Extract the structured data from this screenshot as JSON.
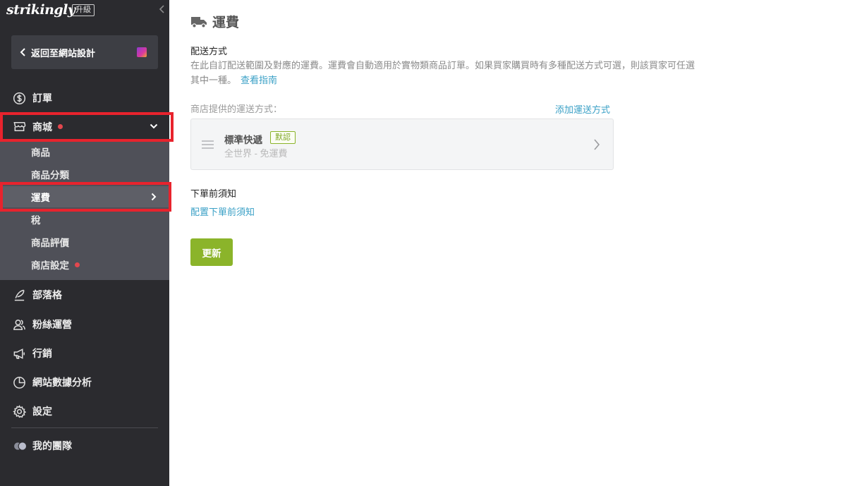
{
  "brand": {
    "logo": "strikingly",
    "upgrade": "升級"
  },
  "sidebar": {
    "back_label": "返回至網站設計",
    "items": {
      "orders": "訂單",
      "store": "商城",
      "blog": "部落格",
      "fans": "粉絲運營",
      "marketing": "行銷",
      "analytics": "網站數據分析",
      "settings": "設定",
      "team": "我的團隊"
    },
    "store_submenu": [
      "商品",
      "商品分類",
      "運費",
      "稅",
      "商品評價",
      "商店設定"
    ],
    "active_submenu": "運費",
    "icons": {
      "orders": "dollar-circle-icon",
      "store": "store-icon",
      "blog": "quill-icon",
      "fans": "people-icon",
      "marketing": "megaphone-icon",
      "analytics": "pie-chart-icon",
      "settings": "gear-icon",
      "team": "team-avatar-icon"
    }
  },
  "main": {
    "title": "運費",
    "section1_title": "配送方式",
    "description": "在此自訂配送範圍及對應的運費。運費會自動適用於實物類商品訂單。如果買家購買時有多種配送方式可選，則該買家可任選其中一種。",
    "guide_link": "查看指南",
    "methods_label": "商店提供的運送方式：",
    "add_method": "添加運送方式",
    "method": {
      "name": "標準快遞",
      "badge": "默認",
      "detail": "全世界 - 免運費"
    },
    "section2_title": "下單前須知",
    "config_link": "配置下單前須知",
    "update_button": "更新"
  },
  "colors": {
    "sidebar_bg": "#2b2b2f",
    "submenu_bg": "#4f5058",
    "highlight": "#e8232d",
    "accent_green": "#8bb42a",
    "link_blue": "#3aa0c6",
    "notify_dot": "#e3474e"
  }
}
